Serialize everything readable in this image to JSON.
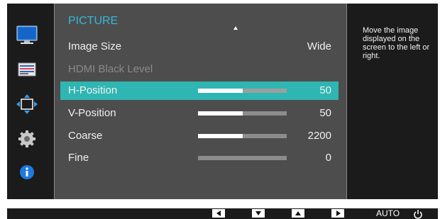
{
  "sidebar": {
    "items": [
      {
        "icon": "picture-monitor-icon"
      },
      {
        "icon": "onscreen-display-icon"
      },
      {
        "icon": "position-arrows-icon"
      },
      {
        "icon": "settings-gear-icon"
      },
      {
        "icon": "information-icon"
      }
    ]
  },
  "menu": {
    "title": "PICTURE",
    "rows": [
      {
        "label": "Image Size",
        "value": "Wide",
        "disabled": false,
        "selected": false,
        "bar": null
      },
      {
        "label": "HDMI Black Level",
        "value": "",
        "disabled": true,
        "selected": false,
        "bar": null
      },
      {
        "label": "H-Position",
        "value": "50",
        "disabled": false,
        "selected": true,
        "bar": 0.5
      },
      {
        "label": "V-Position",
        "value": "50",
        "disabled": false,
        "selected": false,
        "bar": 0.5
      },
      {
        "label": "Coarse",
        "value": "2200",
        "disabled": false,
        "selected": false,
        "bar": 0.5
      },
      {
        "label": "Fine",
        "value": "0",
        "disabled": false,
        "selected": false,
        "bar": 0.0
      }
    ]
  },
  "help": {
    "text": "Move the image displayed on the screen to the left or right."
  },
  "bottom_bar": {
    "keys": [
      "left-arrow-key",
      "down-arrow-key",
      "up-arrow-key",
      "right-arrow-key"
    ],
    "auto_label": "AUTO",
    "power_icon": "power-icon"
  },
  "colors": {
    "title": "#35b8d8",
    "selected_row": "#2fb6b3",
    "panel": "#4d4d4d",
    "frame": "#1b1b1b"
  }
}
